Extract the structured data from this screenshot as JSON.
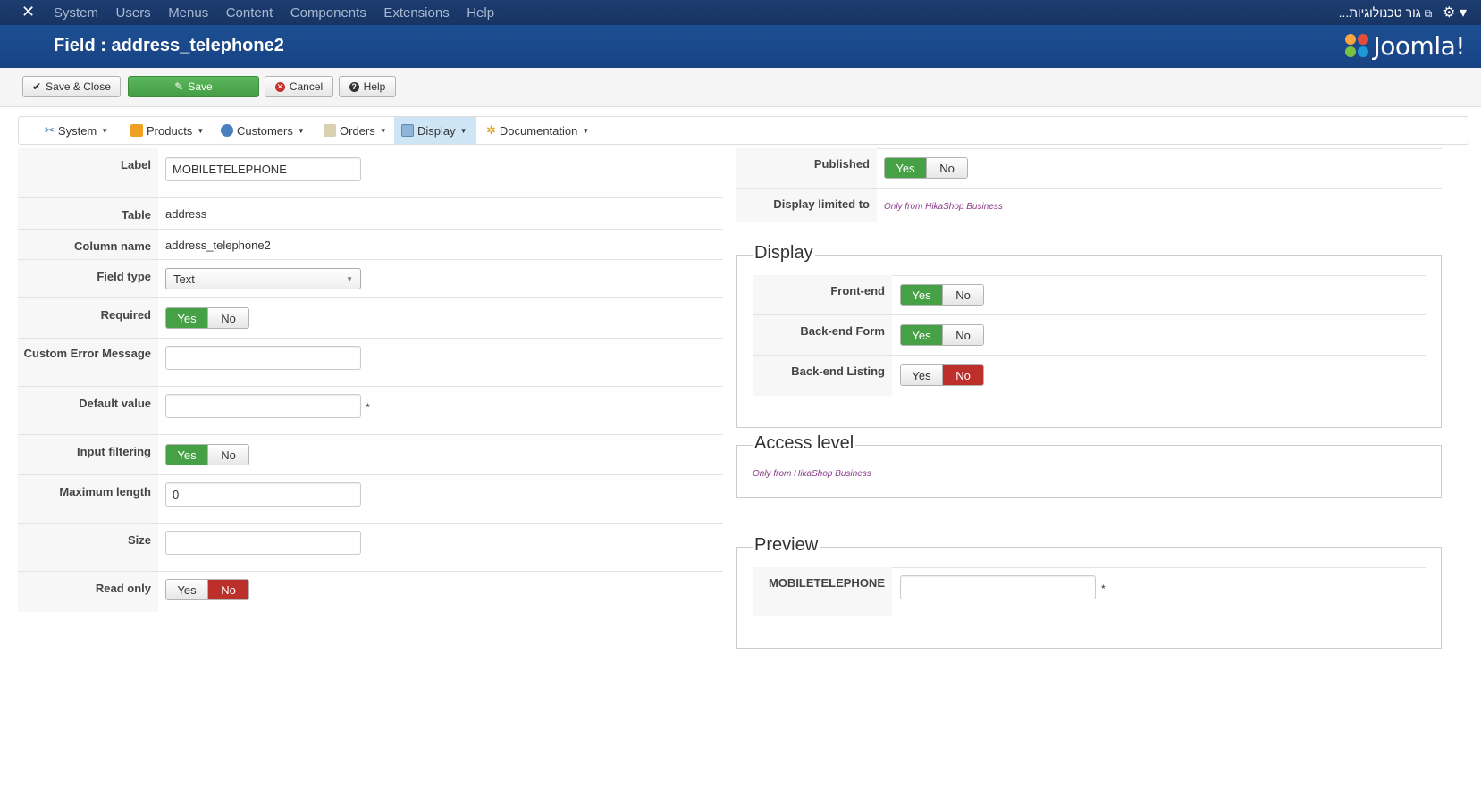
{
  "topbar": {
    "menu": [
      "System",
      "Users",
      "Menus",
      "Content",
      "Components",
      "Extensions",
      "Help"
    ],
    "site_name": "גור טכנולוגיות..."
  },
  "header": {
    "title": "Field : address_telephone2",
    "brand": "Joomla!"
  },
  "toolbar": {
    "save_close": "Save & Close",
    "save": "Save",
    "cancel": "Cancel",
    "help": "Help"
  },
  "hikamenu": [
    "System",
    "Products",
    "Customers",
    "Orders",
    "Display",
    "Documentation"
  ],
  "left": {
    "label": {
      "label": "Label",
      "value": "MOBILETELEPHONE"
    },
    "table": {
      "label": "Table",
      "value": "address"
    },
    "column": {
      "label": "Column name",
      "value": "address_telephone2"
    },
    "fieldtype": {
      "label": "Field type",
      "value": "Text"
    },
    "required": {
      "label": "Required"
    },
    "custom_error": {
      "label": "Custom Error Message",
      "value": ""
    },
    "default_value": {
      "label": "Default value",
      "value": "",
      "star": "*"
    },
    "input_filtering": {
      "label": "Input filtering"
    },
    "max_length": {
      "label": "Maximum length",
      "value": "0"
    },
    "size": {
      "label": "Size",
      "value": ""
    },
    "read_only": {
      "label": "Read only"
    }
  },
  "right": {
    "published": {
      "label": "Published"
    },
    "display_limited": {
      "label": "Display limited to",
      "note": "Only from HikaShop Business"
    },
    "display": {
      "legend": "Display",
      "frontend": "Front-end",
      "backend_form": "Back-end Form",
      "backend_listing": "Back-end Listing"
    },
    "access": {
      "legend": "Access level",
      "note": "Only from HikaShop Business"
    },
    "preview": {
      "legend": "Preview",
      "field_label": "MOBILETELEPHONE",
      "star": "*"
    }
  },
  "yes_no": {
    "yes": "Yes",
    "no": "No"
  },
  "colors": {
    "topbar": "#173463",
    "header": "#1a4b8c",
    "green": "#46a046",
    "red": "#bd2f2b",
    "note": "#8a3a8a"
  }
}
